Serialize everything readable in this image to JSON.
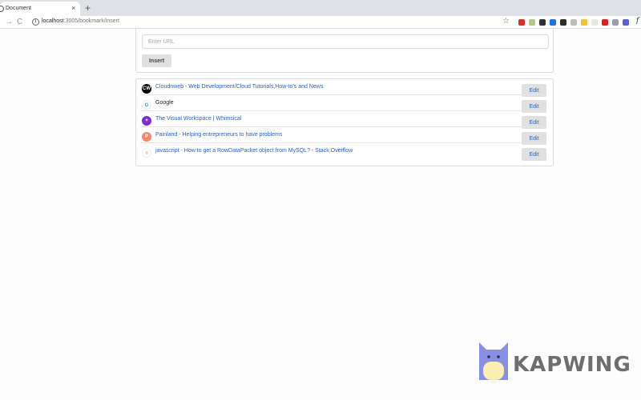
{
  "browser": {
    "tab_title": "Document",
    "tab_close": "×",
    "new_tab": "+",
    "back": "→",
    "reload": "C",
    "url_host": "localhost",
    "url_path": ":3005/bookmark/insert",
    "star": "☆",
    "more": "f",
    "extensions": [
      {
        "name": "ext-red-icon",
        "color": "#d93025"
      },
      {
        "name": "ext-olive-icon",
        "color": "#b9c88a"
      },
      {
        "name": "ext-dropper-icon",
        "color": "#333333"
      },
      {
        "name": "ext-blue-icon",
        "color": "#1a73e8"
      },
      {
        "name": "ext-dark-icon",
        "color": "#2d2d2d"
      },
      {
        "name": "ext-gray-icon",
        "color": "#bdbdbd"
      },
      {
        "name": "ext-yellow-icon",
        "color": "#f2c230"
      },
      {
        "name": "ext-light-icon",
        "color": "#e6e6e6"
      },
      {
        "name": "ext-opera-icon",
        "color": "#e0201b"
      },
      {
        "name": "ext-mid-icon",
        "color": "#9aa0a6"
      },
      {
        "name": "ext-purple-icon",
        "color": "#5b5fd6"
      }
    ]
  },
  "form": {
    "url_placeholder": "Enter URL",
    "insert_label": "Insert"
  },
  "bookmarks": [
    {
      "title": "Cloudnweb - Web Development/Cloud Tutorials,How-to's and News",
      "favicon": "CW",
      "favicon_bg": "#000000",
      "favicon_color": "#ffffff",
      "edit": "Edit",
      "link": true
    },
    {
      "title": "Google",
      "favicon": "G",
      "favicon_bg": "#ffffff",
      "favicon_color": "#4285f4",
      "edit": "Edit",
      "link": false
    },
    {
      "title": "The Visual Workspace | Whimsical",
      "favicon": "✦",
      "favicon_bg": "#7b2fd0",
      "favicon_color": "#ffffff",
      "edit": "Edit",
      "link": true
    },
    {
      "title": "Painland - Helping entrepreneurs to have problems",
      "favicon": "P",
      "favicon_bg": "#f08a6a",
      "favicon_color": "#ffffff",
      "edit": "Edit",
      "link": true
    },
    {
      "title": "javascript - How to get a RowDataPacket object from MySQL? - Stack Overflow",
      "favicon": "≡",
      "favicon_bg": "#ffffff",
      "favicon_color": "#f48024",
      "edit": "Edit",
      "link": true
    }
  ],
  "watermark": {
    "text": "KAPWING"
  },
  "colors": {
    "link": "#2a62c9",
    "button_bg": "#e0e0e0",
    "tab_strip": "#dee1e6"
  }
}
